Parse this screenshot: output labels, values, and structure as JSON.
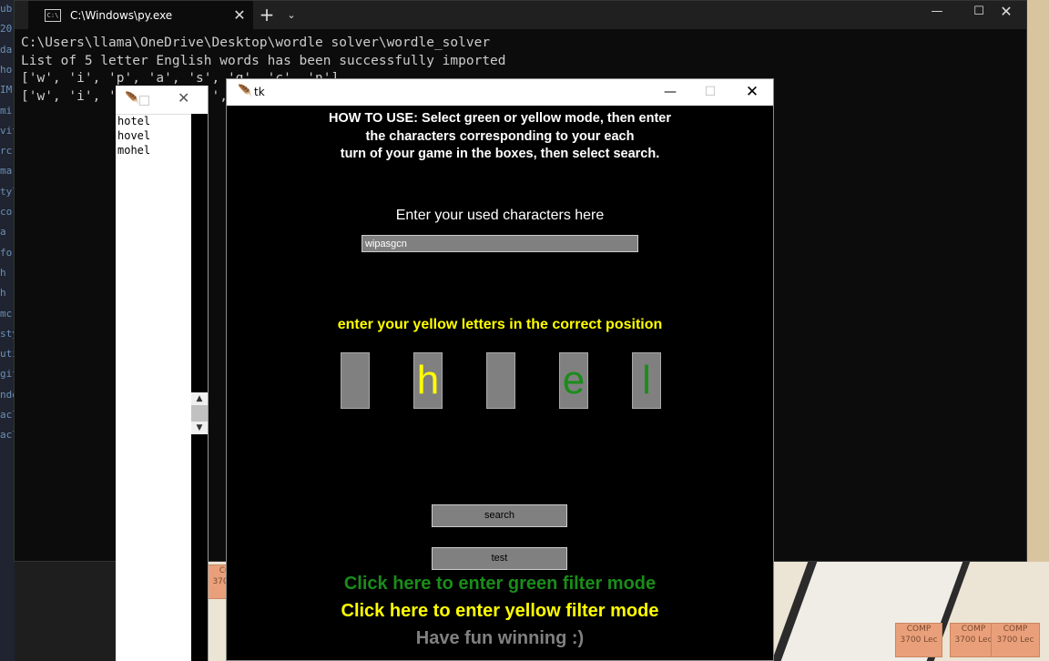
{
  "colors": {
    "green": "#1a8c1a",
    "yellow": "#ffff00",
    "gray": "#808080"
  },
  "editor_strip": [
    "ub",
    "20",
    "da",
    "ho",
    "IM",
    "mi",
    "vit",
    "rc",
    "ma",
    "tyle",
    "co",
    "a",
    "fo",
    "h",
    "h",
    "mc",
    "sty",
    "uti",
    "giti",
    "nde",
    "acl",
    "acl"
  ],
  "map_tiles": [
    "COMP 3700 Lec",
    "COMP 3700 Lec",
    "COMP 3700 Lec",
    "COMP 3700 Lec"
  ],
  "terminal": {
    "tab_title": "C:\\Windows\\py.exe",
    "tab_icon": "C:\\",
    "lines": [
      "C:\\Users\\llama\\OneDrive\\Desktop\\wordle solver\\wordle_solver",
      "List of 5 letter English words has been successfully imported",
      "['w', 'i', 'p', 'a', 's', 'g', 'c', 'n']",
      "['w', 'i', '', '', '', '', '', '']"
    ]
  },
  "wordlist": {
    "items": [
      "hotel",
      "hovel",
      "mohel"
    ]
  },
  "tk": {
    "title": "tk",
    "instructions": [
      "HOW TO USE: Select green or yellow mode, then enter",
      "the characters corresponding to your each",
      "turn of your game in the boxes, then select search."
    ],
    "used_label": "Enter your used characters here",
    "used_value": "wipasgcn",
    "yellow_label": "enter your yellow letters in the correct position",
    "letters": [
      {
        "char": "",
        "color": "yellow"
      },
      {
        "char": "h",
        "color": "yellow"
      },
      {
        "char": "",
        "color": "yellow"
      },
      {
        "char": "e",
        "color": "green"
      },
      {
        "char": "l",
        "color": "green"
      }
    ],
    "search_label": "search",
    "test_label": "test",
    "green_mode": "Click here to enter green filter mode",
    "yellow_mode": "Click here to enter yellow filter mode",
    "fun": "Have fun winning :)"
  }
}
